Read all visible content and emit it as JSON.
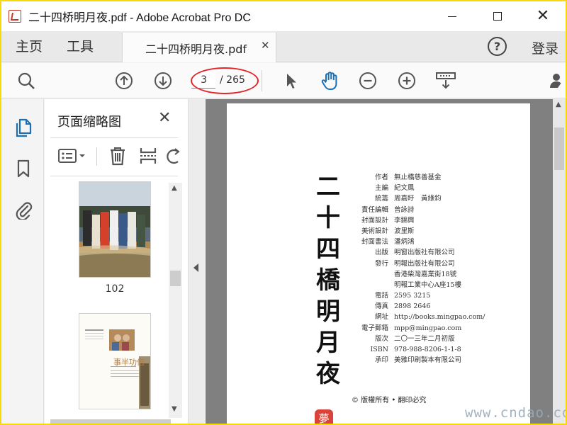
{
  "window": {
    "title": "二十四桥明月夜.pdf - Adobe Acrobat Pro DC",
    "minimize_glyph": "—",
    "close_glyph": "✕"
  },
  "tabs": {
    "home": "主页",
    "tools": "工具",
    "document": "二十四桥明月夜.pdf",
    "document_close": "✕",
    "help": "?",
    "login": "登录"
  },
  "toolbar": {
    "current_page": "3",
    "total_pages": "/ 265",
    "icons": [
      "search-zoom-icon",
      "page-up-icon",
      "page-down-icon",
      "select-cursor-icon",
      "hand-tool-icon",
      "zoom-out-icon",
      "zoom-in-icon",
      "page-fit-icon",
      "account-icon"
    ],
    "accent_color": "#1a6fb5",
    "highlight_color": "#e4252a"
  },
  "sidebar": {
    "rail_icons": [
      "page-thumbnails-icon",
      "bookmarks-icon",
      "attachments-icon"
    ]
  },
  "thumbnail_panel": {
    "title": "页面缩略图",
    "close": "✕",
    "tools": [
      "thumbnail-options-icon",
      "delete-page-icon",
      "split-page-icon",
      "rotate-page-icon"
    ],
    "thumbnails": [
      {
        "label": "102"
      },
      {
        "label": ""
      }
    ],
    "thumb2_heading": "事半功倍"
  },
  "document": {
    "title_chars": [
      "二",
      "十",
      "四",
      "橋",
      "明",
      "月",
      "夜"
    ],
    "info": [
      {
        "label": "作者",
        "value": "無止橋慈善基金"
      },
      {
        "label": "主編",
        "value": "紀文鳳"
      },
      {
        "label": "統籌",
        "value": "周嘉盱　黃綠鈞"
      },
      {
        "label": "責任編輯",
        "value": "曾詠詩"
      },
      {
        "label": "封面設計",
        "value": "李錦興"
      },
      {
        "label": "美術設計",
        "value": "波里斯"
      },
      {
        "label": "封面書法",
        "value": "潘炳鴻"
      },
      {
        "label": "出版",
        "value": "明窗出版社有限公司"
      },
      {
        "label": "發行",
        "value": "明報出版社有限公司"
      },
      {
        "label": "",
        "value": "香港柴灣嘉業街18號"
      },
      {
        "label": "",
        "value": "明報工業中心A座15樓"
      },
      {
        "label": "電話",
        "value": "2595 3215"
      },
      {
        "label": "傳真",
        "value": "2898 2646"
      },
      {
        "label": "網址",
        "value": "http://books.mingpao.com/"
      },
      {
        "label": "電子郵箱",
        "value": "mpp@mingpao.com"
      },
      {
        "label": "版次",
        "value": "二〇一三年二月初版"
      },
      {
        "label": "ISBN",
        "value": "978-988-8206-1-1-8"
      },
      {
        "label": "承印",
        "value": "美雅印刷製本有限公司"
      }
    ],
    "copyright": "© 版權所有 • 翻印必究",
    "seal_char": "夢"
  },
  "watermark": "www.cndao.com"
}
